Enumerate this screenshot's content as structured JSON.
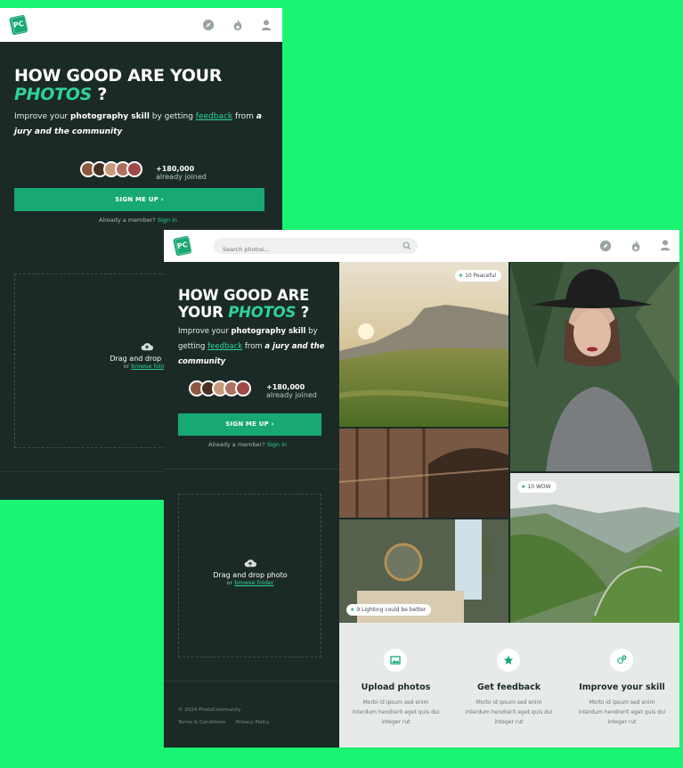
{
  "brand": {
    "logo_text": "PC",
    "accent_color": "#17a873",
    "highlight_color": "#2ed39a",
    "background_color": "#1af574"
  },
  "nav_icons": [
    "compass-icon",
    "fire-icon",
    "user-icon"
  ],
  "hero": {
    "title_line1": "HOW GOOD ARE YOUR",
    "title_line1_a": "HOW GOOD ARE",
    "title_line2_a": "YOUR",
    "title_accent": "PHOTOS",
    "title_q": "?",
    "sub_1": "Improve your",
    "sub_bold": "photography skill",
    "sub_2": "by getting",
    "sub_link": "feedback",
    "sub_3": "from",
    "sub_italic": "a jury and the community",
    "joined_count": "+180,000",
    "joined_text": "already joined",
    "cta": "SIGN ME UP",
    "already_text": "Already a member?",
    "sign_in": "Sign in"
  },
  "upload": {
    "title": "Drag and drop photo",
    "or_text": "or",
    "browse_link": "browse folder"
  },
  "search": {
    "placeholder": "Search photos..."
  },
  "photos": [
    {
      "badge_count": "10",
      "badge_text": "Peaceful"
    },
    {
      "badge_count": "10",
      "badge_text": "WOW"
    },
    {
      "badge_count": "9",
      "badge_text": "Lighting could be better"
    }
  ],
  "footer": {
    "copyright": "© 2024 PhotoCommunity",
    "links": [
      "Terms & Conditions",
      "Privacy Policy"
    ]
  },
  "features": [
    {
      "icon": "image-icon",
      "title": "Upload photos",
      "text": "Morbi id ipsum sed enim interdum hendrerit eget quis dui integer rut"
    },
    {
      "icon": "star-icon",
      "title": "Get feedback",
      "text": "Morbi id ipsum sed enim interdum hendrerit eget quis dui integer rut"
    },
    {
      "icon": "gears-icon",
      "title": "Improve your skill",
      "text": "Morbi id ipsum sed enim interdum hendrerit eget quis dui integer rut"
    }
  ]
}
